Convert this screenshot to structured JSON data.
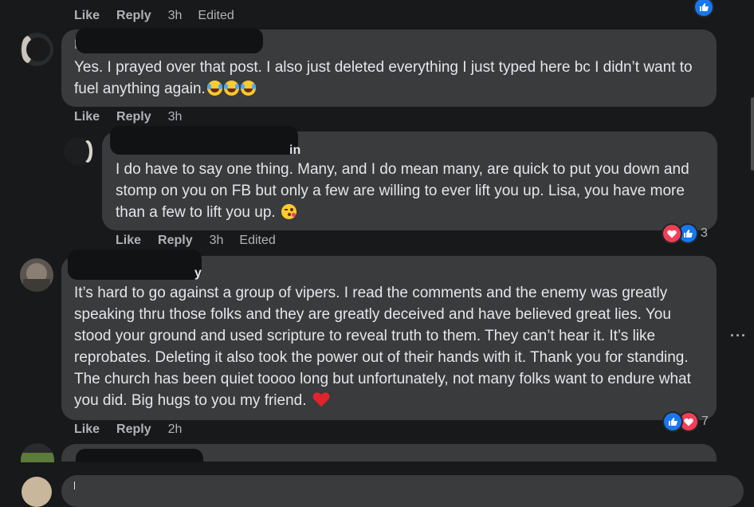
{
  "top_actions": {
    "like": "Like",
    "reply": "Reply",
    "time": "3h",
    "edited": "Edited"
  },
  "comment1": {
    "name_visible": "l",
    "text": "Yes. I prayed over that post. I also just deleted everything I just typed here bc I didn’t want to fuel anything again.",
    "like": "Like",
    "reply": "Reply",
    "time": "3h"
  },
  "reply1": {
    "name_visible": "in",
    "text": "I do have to say one thing. Many, and I do mean many, are quick to put you down and stomp on you on FB but only a few are willing to ever lift you up. Lisa, you have more than a few to lift you up.",
    "like": "Like",
    "reply": "Reply",
    "time": "3h",
    "edited": "Edited",
    "reaction_count": "3"
  },
  "comment2": {
    "name_visible": "y",
    "text": "It’s hard to go against a group of vipers. I read the comments and the enemy was greatly speaking thru those folks and they are greatly deceived and have believed great lies. You stood your ground and used scripture to reveal truth to them. They can’t hear it. It’s like reprobates. Deleting it also took the power out of their hands with it. Thank you for standing. The church has been quiet toooo long but unfortunately, not many folks want to endure what you did. Big hugs to you my friend.",
    "like": "Like",
    "reply": "Reply",
    "time": "2h",
    "reaction_count": "7",
    "more_options": "···"
  },
  "icons": {
    "like": "like-thumb-icon",
    "love": "love-heart-icon",
    "more": "more-options-icon",
    "emoji": "tears-of-joy-emoji"
  },
  "colors": {
    "background": "#18191a",
    "bubble": "#3a3b3c",
    "text": "#e4e6eb",
    "secondary": "#b0b3b8",
    "like_blue": "#1877f2",
    "love_red": "#f33e58"
  }
}
